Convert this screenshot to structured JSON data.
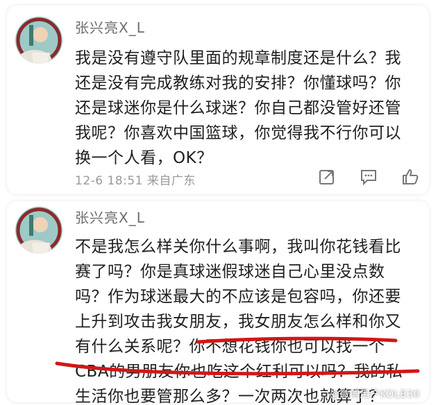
{
  "comments": [
    {
      "username": "张兴亮X_L",
      "lines": [
        "我是没有遵守队里面的规章制度还是什么？我",
        "还是没有完成教练对我的安排？你懂球吗？你",
        "还是球迷你是什么球迷？你自己都没管好还管",
        "我呢？你喜欢中国篮球，你觉得我不行你可以",
        "换一个人看，OK？"
      ],
      "meta": "12-6 18:51 来自广东",
      "actions": [
        "share-icon",
        "comment-icon",
        "like-icon"
      ]
    },
    {
      "username": "张兴亮X_L",
      "lines": [
        "不是我怎么样关你什么事啊，我叫你花钱看比",
        "赛了吗？你是真球迷假球迷自己心里没点数",
        "吗？作为球迷最大的不应该是包容吗，你还要",
        "上升到攻击我女朋友，我女朋友怎么样和你又",
        "有什么关系呢？你不想花钱你也可以找一个",
        "CBA的男朋友你也吃这个红利可以吗？我的私",
        "生活你也要管那么多？一次两次也就算了？"
      ]
    }
  ],
  "annotation_color": "#d11717",
  "watermark": "@微博用户KOLB30"
}
